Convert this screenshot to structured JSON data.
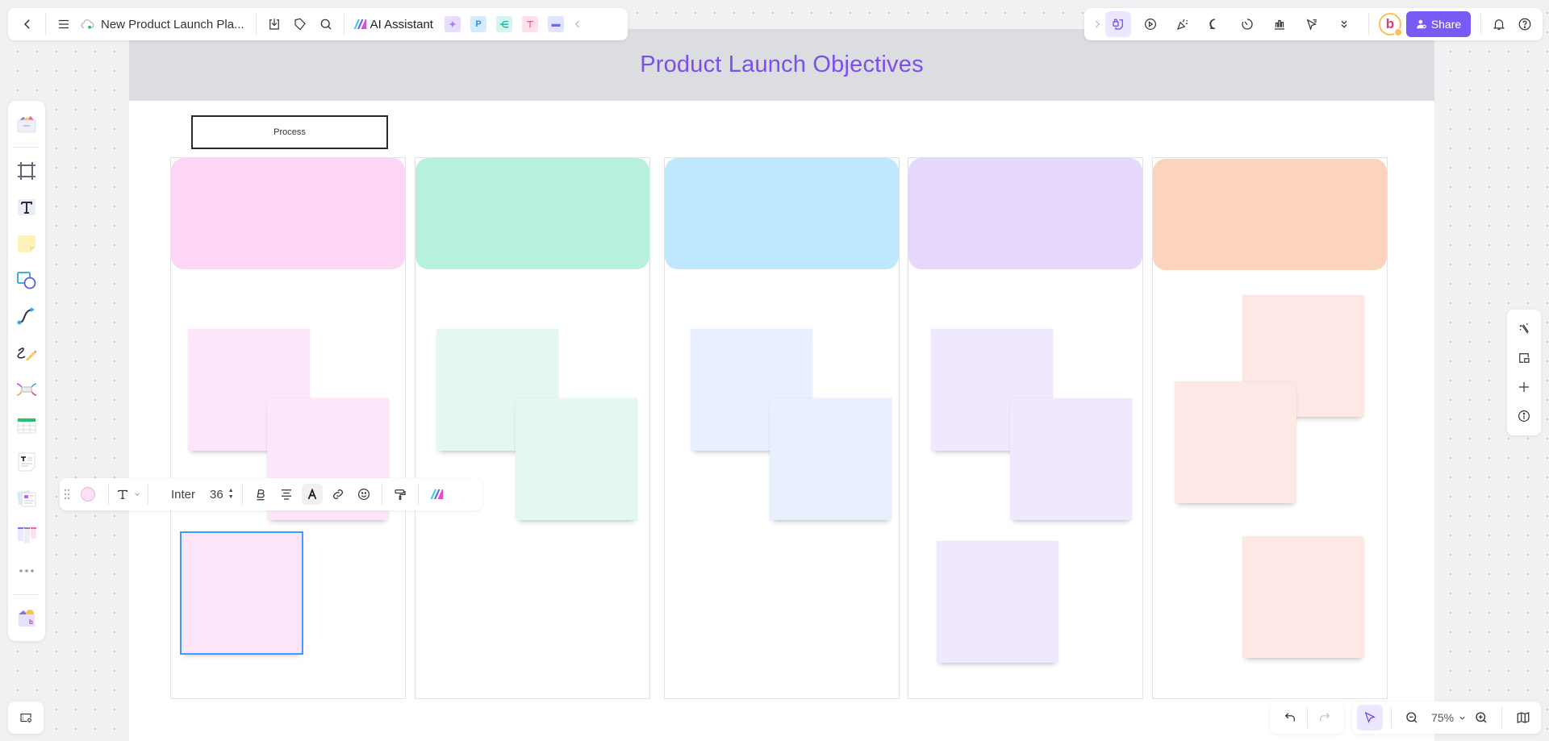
{
  "topbar": {
    "doc_title": "New Product Launch Pla...",
    "ai_assistant_label": "AI Assistant",
    "app_chips": [
      {
        "name": "image-app",
        "glyph": "✦",
        "bg": "#e9ddff",
        "fg": "#a779f0"
      },
      {
        "name": "presentation-app",
        "glyph": "P",
        "bg": "#d3ecff",
        "fg": "#2f8de6"
      },
      {
        "name": "mindmap-app",
        "glyph": "⋲",
        "bg": "#d4f5f0",
        "fg": "#17b9a3"
      },
      {
        "name": "flowchart-app",
        "glyph": "⊤",
        "bg": "#ffe0ec",
        "fg": "#e8508b"
      },
      {
        "name": "chat-app",
        "glyph": "▬",
        "bg": "#e1e3ff",
        "fg": "#6a6ff0"
      }
    ],
    "share_label": "Share",
    "avatar_initial": "b"
  },
  "board": {
    "title": "Product Launch Objectives",
    "process_label": "Process",
    "lanes": [
      {
        "header_color": "#fdd5f5",
        "notes": [
          {
            "color": "#fde6f9"
          },
          {
            "color": "#fde6f9"
          },
          {
            "color": "#fde6f9",
            "selected": true
          }
        ]
      },
      {
        "header_color": "#b6f1dd",
        "notes": [
          {
            "color": "#e4f8ef"
          },
          {
            "color": "#e4f8ef"
          }
        ]
      },
      {
        "header_color": "#c0e8fd",
        "notes": [
          {
            "color": "#e8f0fd"
          },
          {
            "color": "#e8f0fd"
          }
        ]
      },
      {
        "header_color": "#e6d7fd",
        "notes": [
          {
            "color": "#f0e9fd"
          },
          {
            "color": "#f0e9fd"
          },
          {
            "color": "#f0e9fd"
          }
        ]
      },
      {
        "header_color": "#fcd4bd",
        "notes": [
          {
            "color": "#fde8e6"
          },
          {
            "color": "#fde8e6"
          },
          {
            "color": "#fde8e6"
          }
        ]
      }
    ]
  },
  "format_bar": {
    "fill_color": "#fde1f7",
    "font_name": "Inter",
    "font_size": "36"
  },
  "zoom": {
    "level": "75%"
  },
  "colors": {
    "accent": "#7a5af5",
    "selection": "#3f9bff",
    "title": "#7a4fee"
  }
}
